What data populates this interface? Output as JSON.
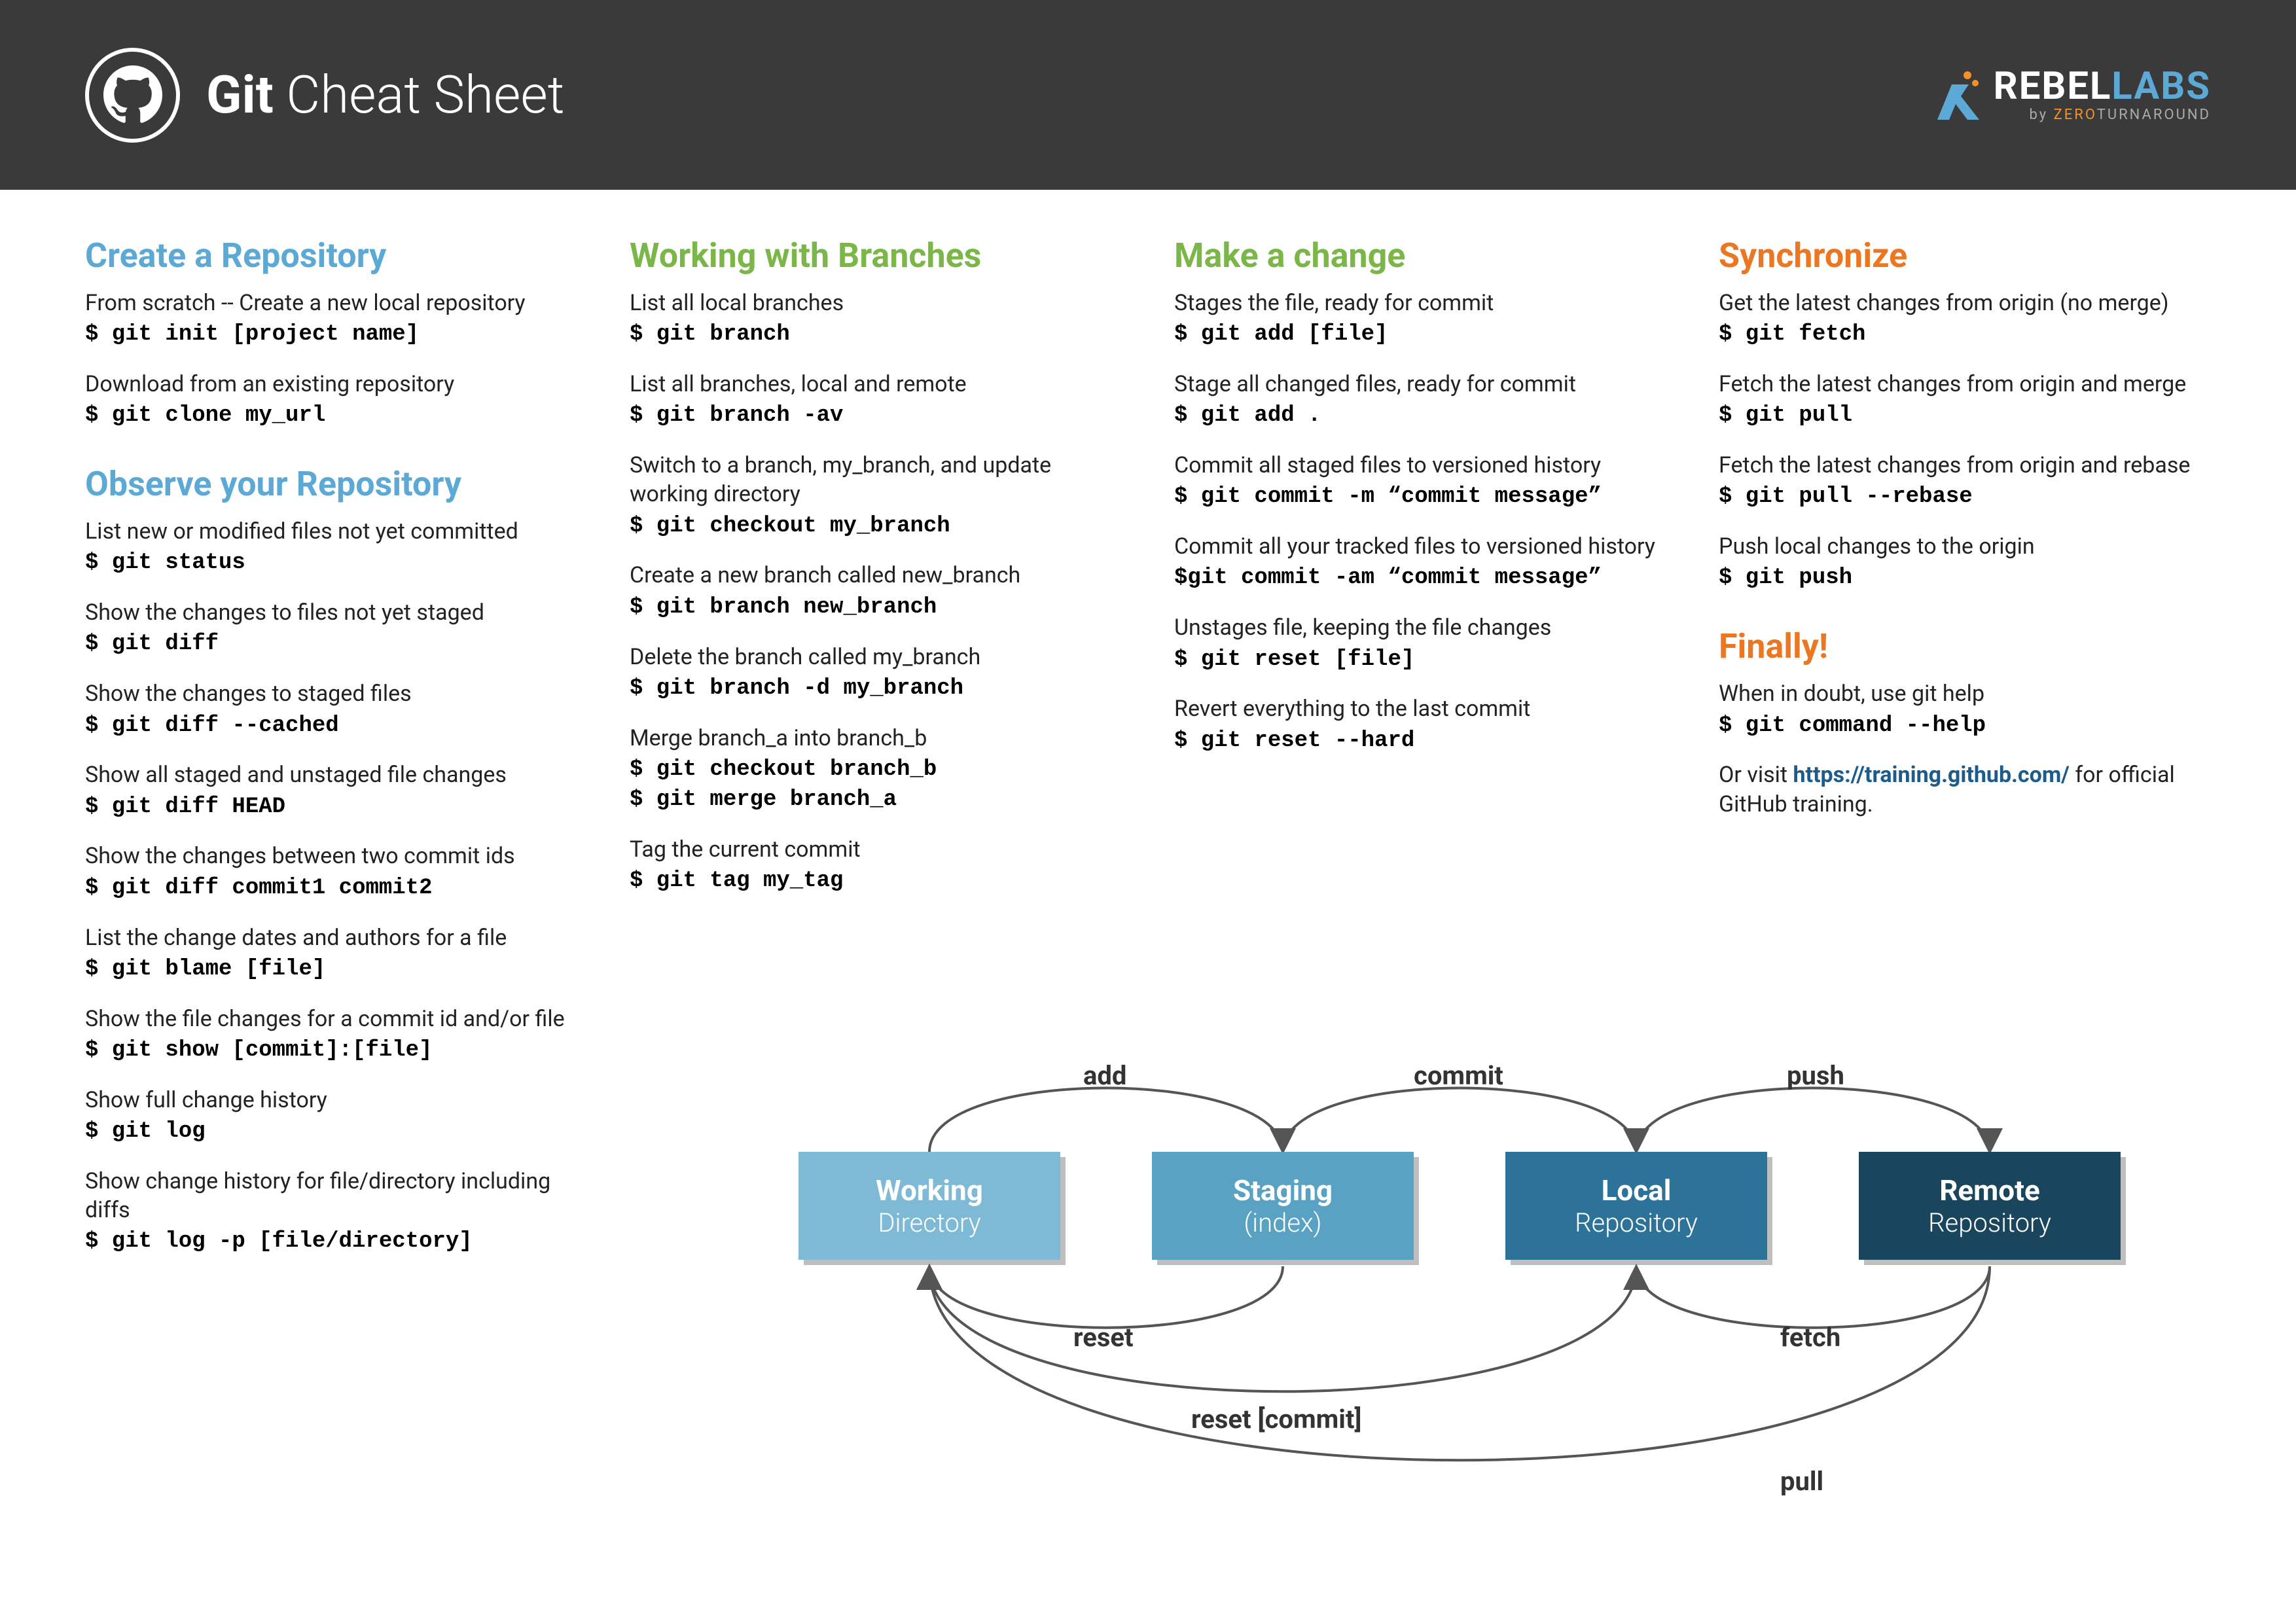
{
  "header": {
    "title_bold": "Git",
    "title_rest": " Cheat Sheet",
    "brand_white": "REBEL",
    "brand_blue": "LABS",
    "brand_sub_prefix": "by ",
    "brand_sub_orange": "ZERO",
    "brand_sub_rest": "TURNAROUND"
  },
  "col1": {
    "h_create": "Create a Repository",
    "e1_desc": "From scratch -- Create a new local repository",
    "e1_cmd": "$ git init [project name]",
    "e2_desc": "Download from an existing repository",
    "e2_cmd": "$ git clone my_url",
    "h_observe": "Observe your Repository",
    "e3_desc": "List new or modified files not yet committed",
    "e3_cmd": "$ git status",
    "e4_desc": "Show the changes to files not yet staged",
    "e4_cmd": "$ git diff",
    "e5_desc": "Show the changes to staged files",
    "e5_cmd": "$ git diff --cached",
    "e6_desc": "Show all staged and unstaged file changes",
    "e6_cmd": "$ git diff HEAD",
    "e7_desc": "Show the changes between two commit ids",
    "e7_cmd": "$ git diff commit1 commit2",
    "e8_desc": "List the change dates and authors for a file",
    "e8_cmd": "$ git blame [file]",
    "e9_desc": "Show the file changes for a commit id and/or file",
    "e9_cmd": "$ git show [commit]:[file]",
    "e10_desc": "Show full change history",
    "e10_cmd": "$ git log",
    "e11_desc": "Show change history for file/directory including diffs",
    "e11_cmd": "$ git log -p [file/directory]"
  },
  "col2": {
    "h_branch": "Working with Branches",
    "e1_desc": "List all local branches",
    "e1_cmd": "$ git branch",
    "e2_desc": "List all branches, local and remote",
    "e2_cmd": "$ git branch -av",
    "e3_desc": "Switch to a branch, my_branch, and update working directory",
    "e3_cmd": "$ git checkout my_branch",
    "e4_desc": "Create a new branch called new_branch",
    "e4_cmd": "$ git branch new_branch",
    "e5_desc": "Delete the branch called my_branch",
    "e5_cmd": "$ git branch -d my_branch",
    "e6_desc": "Merge branch_a into branch_b",
    "e6_cmd1": "$ git checkout branch_b",
    "e6_cmd2": "$ git merge branch_a",
    "e7_desc": "Tag the current commit",
    "e7_cmd": "$ git tag my_tag"
  },
  "col3": {
    "h_change": "Make a change",
    "e1_desc": "Stages the file, ready for commit",
    "e1_cmd": "$ git add [file]",
    "e2_desc": "Stage all changed files, ready for commit",
    "e2_cmd": "$ git add .",
    "e3_desc": "Commit all staged files to versioned history",
    "e3_cmd": "$ git commit -m “commit message”",
    "e4_desc": "Commit all your tracked files to versioned history",
    "e4_cmd": "$git commit -am “commit message”",
    "e5_desc": "Unstages file, keeping the file changes",
    "e5_cmd": "$ git reset [file]",
    "e6_desc": "Revert everything to the last commit",
    "e6_cmd": "$ git reset --hard"
  },
  "col4": {
    "h_sync": "Synchronize",
    "e1_desc": "Get the latest changes from origin (no merge)",
    "e1_cmd": "$ git fetch",
    "e2_desc": "Fetch the latest changes from origin and merge",
    "e2_cmd": "$ git pull",
    "e3_desc": "Fetch the latest changes from origin and rebase",
    "e3_cmd": "$ git pull --rebase",
    "e4_desc": "Push local changes to the origin",
    "e4_cmd": "$ git push",
    "h_finally": "Finally!",
    "e5_desc": "When in doubt, use git help",
    "e5_cmd": "$ git command --help",
    "e6_desc1": "Or visit ",
    "e6_link": "https://training.github.com/",
    "e6_desc2": " for official GitHub training."
  },
  "diagram": {
    "box1_a": "Working",
    "box1_b": "Directory",
    "box2_a": "Staging",
    "box2_b": "(index)",
    "box3_a": "Local",
    "box3_b": "Repository",
    "box4_a": "Remote",
    "box4_b": "Repository",
    "l_add": "add",
    "l_commit": "commit",
    "l_push": "push",
    "l_reset": "reset",
    "l_fetch": "fetch",
    "l_resetcommit": "reset [commit]",
    "l_pull": "pull"
  }
}
